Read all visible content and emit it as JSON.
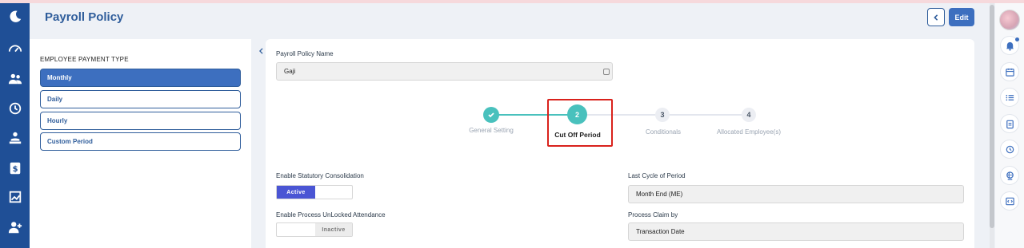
{
  "page": {
    "title": "Payroll Policy"
  },
  "header": {
    "edit_label": "Edit"
  },
  "payment_type": {
    "heading": "EMPLOYEE PAYMENT TYPE",
    "options": [
      "Monthly",
      "Daily",
      "Hourly",
      "Custom Period"
    ],
    "selected": "Monthly"
  },
  "form": {
    "policy_name_label": "Payroll Policy Name",
    "policy_name_value": "Gaji",
    "statutory_label": "Enable Statutory Consolidation",
    "statutory_state": "Active",
    "unlocked_label": "Enable Process UnLocked Attendance",
    "unlocked_state": "Inactive",
    "last_cycle_label": "Last Cycle of Period",
    "last_cycle_value": "Month End (ME)",
    "claim_label": "Process Claim by",
    "claim_value": "Transaction Date"
  },
  "stepper": {
    "current_step": 2,
    "steps": [
      {
        "number": "1",
        "label": "General Setting",
        "state": "done"
      },
      {
        "number": "2",
        "label": "Cut Off Period",
        "state": "active"
      },
      {
        "number": "3",
        "label": "Conditionals",
        "state": "pending"
      },
      {
        "number": "4",
        "label": "Allocated Employee(s)",
        "state": "pending"
      }
    ]
  },
  "colors": {
    "nav_bg": "#1f4f96",
    "accent": "#3d6fbf",
    "step_active": "#49c1bd",
    "toggle_active": "#4a55d4",
    "highlight": "#d9221c"
  },
  "icons": {
    "nav": [
      "moon-logo-icon",
      "dashboard-gauge-icon",
      "people-icon",
      "clock-history-icon",
      "employee-hand-icon",
      "dollar-icon",
      "chart-icon",
      "user-add-icon"
    ],
    "rail": [
      "bell-icon",
      "calendar-icon",
      "list-icon",
      "clipboard-icon",
      "clock-icon",
      "globe-icon",
      "code-icon"
    ]
  }
}
